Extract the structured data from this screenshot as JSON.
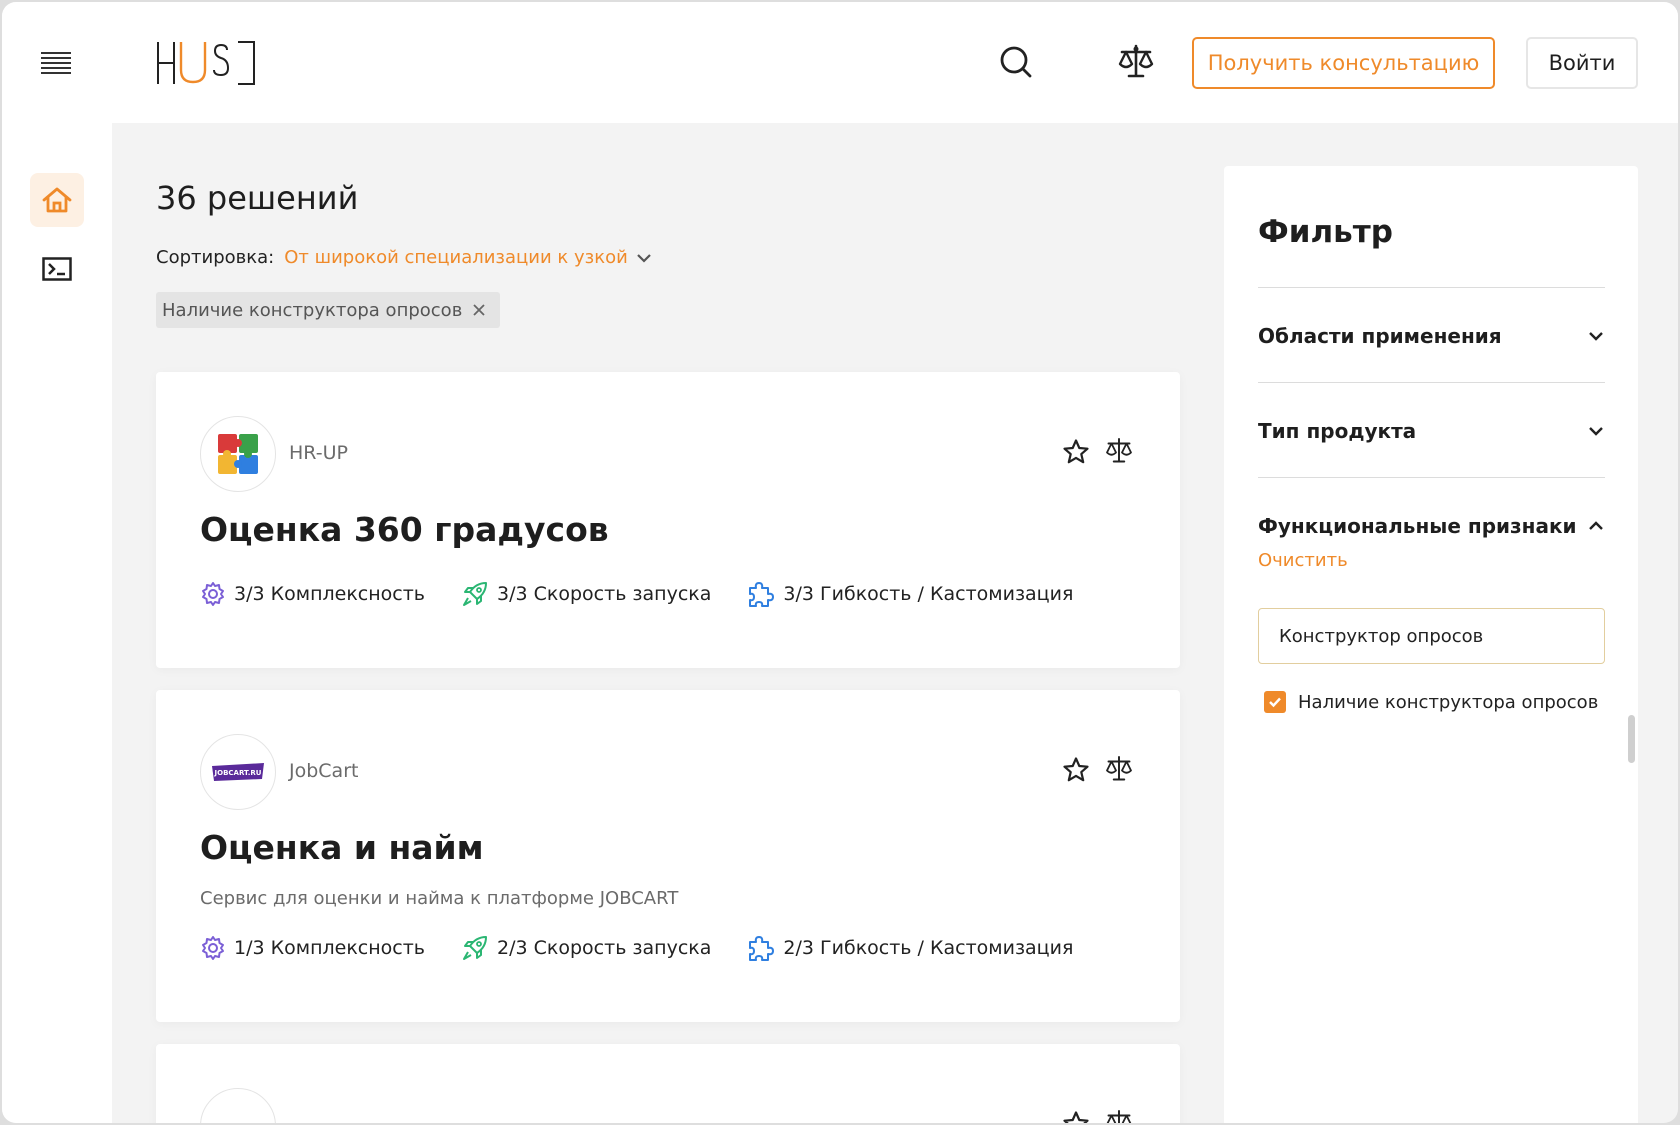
{
  "header": {
    "consult_label": "Получить консультацию",
    "login_label": "Войти"
  },
  "main": {
    "results_title": "36 решений",
    "sort_label": "Сортировка:",
    "sort_value": "От широкой специализации к узкой",
    "active_chip": "Наличие конструктора опросов",
    "cards": [
      {
        "vendor": "HR-UP",
        "title": "Оценка 360 градусов",
        "description": "",
        "metrics": [
          {
            "icon": "gear-icon",
            "text": "3/3 Комплексность"
          },
          {
            "icon": "rocket-icon",
            "text": "3/3 Скорость запуска"
          },
          {
            "icon": "puzzle-icon",
            "text": "3/3 Гибкость / Кастомизация"
          }
        ]
      },
      {
        "vendor": "JobCart",
        "logo_text": "JOBCART.RU",
        "title": "Оценка и найм",
        "description": "Сервис для оценки и найма к платформе JOBCART",
        "metrics": [
          {
            "icon": "gear-icon",
            "text": "1/3 Комплексность"
          },
          {
            "icon": "rocket-icon",
            "text": "2/3 Скорость запуска"
          },
          {
            "icon": "puzzle-icon",
            "text": "2/3 Гибкость / Кастомизация"
          }
        ]
      }
    ]
  },
  "filter": {
    "title": "Фильтр",
    "sections": [
      {
        "label": "Области применения",
        "expanded": false
      },
      {
        "label": "Тип продукта",
        "expanded": false
      },
      {
        "label": "Функциональные признаки",
        "expanded": true
      }
    ],
    "clear_label": "Очистить",
    "search_value": "Конструктор опросов",
    "checkbox_label": "Наличие конструктора опросов",
    "checkbox_checked": true
  },
  "colors": {
    "accent": "#ef8a2a",
    "gear": "#7b5fd6",
    "rocket": "#2bb673",
    "puzzle": "#2f7fe0"
  }
}
